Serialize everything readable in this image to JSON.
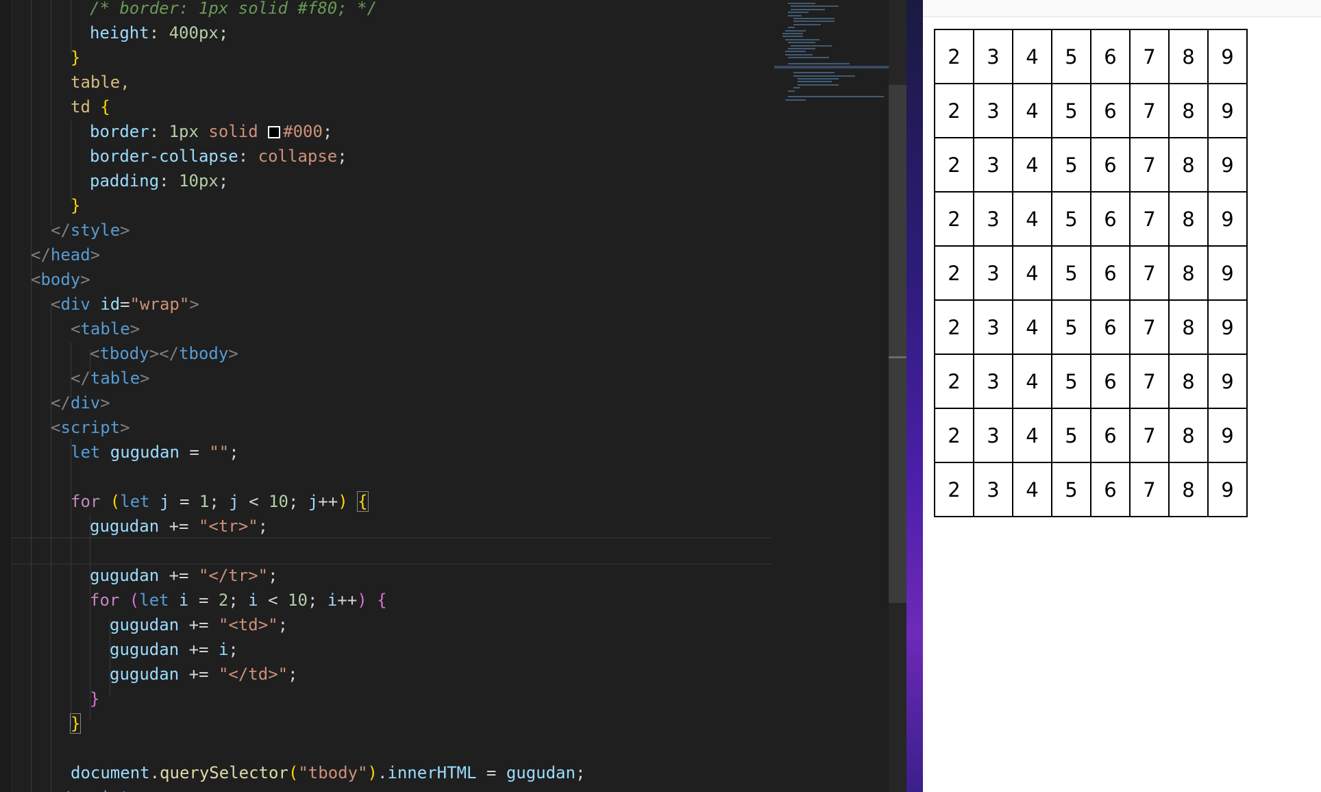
{
  "editor": {
    "lines": [
      [
        {
          "t": "/* border: 1px solid #f80; */",
          "c": "comment"
        }
      ],
      [
        {
          "t": "height",
          "c": "prop"
        },
        {
          "t": ": ",
          "c": "plain"
        },
        {
          "t": "400px",
          "c": "num"
        },
        {
          "t": ";",
          "c": "plain"
        }
      ],
      [
        {
          "t": "}",
          "c": "brace1"
        }
      ],
      [
        {
          "t": "table,",
          "c": "sel"
        }
      ],
      [
        {
          "t": "td ",
          "c": "sel"
        },
        {
          "t": "{",
          "c": "brace1"
        }
      ],
      [
        {
          "t": "border",
          "c": "prop"
        },
        {
          "t": ": ",
          "c": "plain"
        },
        {
          "t": "1px",
          "c": "num"
        },
        {
          "t": " solid ",
          "c": "cssval"
        },
        {
          "t": "",
          "c": "swatch"
        },
        {
          "t": "#000",
          "c": "cssval"
        },
        {
          "t": ";",
          "c": "plain"
        }
      ],
      [
        {
          "t": "border-collapse",
          "c": "prop"
        },
        {
          "t": ": ",
          "c": "plain"
        },
        {
          "t": "collapse",
          "c": "cssval"
        },
        {
          "t": ";",
          "c": "plain"
        }
      ],
      [
        {
          "t": "padding",
          "c": "prop"
        },
        {
          "t": ": ",
          "c": "plain"
        },
        {
          "t": "10px",
          "c": "num"
        },
        {
          "t": ";",
          "c": "plain"
        }
      ],
      [
        {
          "t": "}",
          "c": "brace1"
        }
      ],
      [
        {
          "t": "</",
          "c": "punct"
        },
        {
          "t": "style",
          "c": "tag"
        },
        {
          "t": ">",
          "c": "punct"
        }
      ],
      [
        {
          "t": "</",
          "c": "punct"
        },
        {
          "t": "head",
          "c": "tag"
        },
        {
          "t": ">",
          "c": "punct"
        }
      ],
      [
        {
          "t": "<",
          "c": "punct"
        },
        {
          "t": "body",
          "c": "tag"
        },
        {
          "t": ">",
          "c": "punct"
        }
      ],
      [
        {
          "t": "<",
          "c": "punct"
        },
        {
          "t": "div ",
          "c": "tag"
        },
        {
          "t": "id",
          "c": "attr"
        },
        {
          "t": "=",
          "c": "plain"
        },
        {
          "t": "\"wrap\"",
          "c": "attrval"
        },
        {
          "t": ">",
          "c": "punct"
        }
      ],
      [
        {
          "t": "<",
          "c": "punct"
        },
        {
          "t": "table",
          "c": "tag"
        },
        {
          "t": ">",
          "c": "punct"
        }
      ],
      [
        {
          "t": "<",
          "c": "punct"
        },
        {
          "t": "tbody",
          "c": "tag"
        },
        {
          "t": "></",
          "c": "punct"
        },
        {
          "t": "tbody",
          "c": "tag"
        },
        {
          "t": ">",
          "c": "punct"
        }
      ],
      [
        {
          "t": "</",
          "c": "punct"
        },
        {
          "t": "table",
          "c": "tag"
        },
        {
          "t": ">",
          "c": "punct"
        }
      ],
      [
        {
          "t": "</",
          "c": "punct"
        },
        {
          "t": "div",
          "c": "tag"
        },
        {
          "t": ">",
          "c": "punct"
        }
      ],
      [
        {
          "t": "<",
          "c": "punct"
        },
        {
          "t": "script",
          "c": "tag"
        },
        {
          "t": ">",
          "c": "punct"
        }
      ],
      [
        {
          "t": "let ",
          "c": "kw"
        },
        {
          "t": "gugudan",
          "c": "var"
        },
        {
          "t": " = ",
          "c": "plain"
        },
        {
          "t": "\"\"",
          "c": "str"
        },
        {
          "t": ";",
          "c": "plain"
        }
      ],
      [],
      [
        {
          "t": "for ",
          "c": "ctrl"
        },
        {
          "t": "(",
          "c": "brace1"
        },
        {
          "t": "let ",
          "c": "kw"
        },
        {
          "t": "j",
          "c": "var"
        },
        {
          "t": " = ",
          "c": "plain"
        },
        {
          "t": "1",
          "c": "num"
        },
        {
          "t": "; ",
          "c": "plain"
        },
        {
          "t": "j",
          "c": "var"
        },
        {
          "t": " < ",
          "c": "plain"
        },
        {
          "t": "10",
          "c": "num"
        },
        {
          "t": "; ",
          "c": "plain"
        },
        {
          "t": "j",
          "c": "var"
        },
        {
          "t": "++",
          "c": "plain"
        },
        {
          "t": ") ",
          "c": "brace1"
        },
        {
          "t": "{",
          "c": "brace1 boxed"
        }
      ],
      [
        {
          "t": "gugudan",
          "c": "var"
        },
        {
          "t": " += ",
          "c": "plain"
        },
        {
          "t": "\"<tr>\"",
          "c": "str"
        },
        {
          "t": ";",
          "c": "plain"
        }
      ],
      [],
      [
        {
          "t": "gugudan",
          "c": "var"
        },
        {
          "t": " += ",
          "c": "plain"
        },
        {
          "t": "\"</tr>\"",
          "c": "str"
        },
        {
          "t": ";",
          "c": "plain"
        }
      ],
      [
        {
          "t": "for ",
          "c": "ctrl"
        },
        {
          "t": "(",
          "c": "brace2"
        },
        {
          "t": "let ",
          "c": "kw"
        },
        {
          "t": "i",
          "c": "var"
        },
        {
          "t": " = ",
          "c": "plain"
        },
        {
          "t": "2",
          "c": "num"
        },
        {
          "t": "; ",
          "c": "plain"
        },
        {
          "t": "i",
          "c": "var"
        },
        {
          "t": " < ",
          "c": "plain"
        },
        {
          "t": "10",
          "c": "num"
        },
        {
          "t": "; ",
          "c": "plain"
        },
        {
          "t": "i",
          "c": "var"
        },
        {
          "t": "++",
          "c": "plain"
        },
        {
          "t": ") ",
          "c": "brace2"
        },
        {
          "t": "{",
          "c": "brace2"
        }
      ],
      [
        {
          "t": "gugudan",
          "c": "var"
        },
        {
          "t": " += ",
          "c": "plain"
        },
        {
          "t": "\"<td>\"",
          "c": "str"
        },
        {
          "t": ";",
          "c": "plain"
        }
      ],
      [
        {
          "t": "gugudan",
          "c": "var"
        },
        {
          "t": " += ",
          "c": "plain"
        },
        {
          "t": "i",
          "c": "var"
        },
        {
          "t": ";",
          "c": "plain"
        }
      ],
      [
        {
          "t": "gugudan",
          "c": "var"
        },
        {
          "t": " += ",
          "c": "plain"
        },
        {
          "t": "\"</td>\"",
          "c": "str"
        },
        {
          "t": ";",
          "c": "plain"
        }
      ],
      [
        {
          "t": "}",
          "c": "brace2"
        }
      ],
      [
        {
          "t": "}",
          "c": "brace1 boxed"
        }
      ],
      [],
      [
        {
          "t": "document",
          "c": "var"
        },
        {
          "t": ".",
          "c": "plain"
        },
        {
          "t": "querySelector",
          "c": "fn"
        },
        {
          "t": "(",
          "c": "brace1"
        },
        {
          "t": "\"tbody\"",
          "c": "str"
        },
        {
          "t": ")",
          "c": "brace1"
        },
        {
          "t": ".",
          "c": "plain"
        },
        {
          "t": "innerHTML",
          "c": "var"
        },
        {
          "t": " = ",
          "c": "plain"
        },
        {
          "t": "gugudan",
          "c": "var"
        },
        {
          "t": ";",
          "c": "plain"
        }
      ],
      [
        {
          "t": "</",
          "c": "punct"
        },
        {
          "t": "script",
          "c": "tag"
        },
        {
          "t": ">",
          "c": "punct"
        }
      ]
    ]
  },
  "browser": {
    "table_rows": [
      [
        "2",
        "3",
        "4",
        "5",
        "6",
        "7",
        "8",
        "9"
      ],
      [
        "2",
        "3",
        "4",
        "5",
        "6",
        "7",
        "8",
        "9"
      ],
      [
        "2",
        "3",
        "4",
        "5",
        "6",
        "7",
        "8",
        "9"
      ],
      [
        "2",
        "3",
        "4",
        "5",
        "6",
        "7",
        "8",
        "9"
      ],
      [
        "2",
        "3",
        "4",
        "5",
        "6",
        "7",
        "8",
        "9"
      ],
      [
        "2",
        "3",
        "4",
        "5",
        "6",
        "7",
        "8",
        "9"
      ],
      [
        "2",
        "3",
        "4",
        "5",
        "6",
        "7",
        "8",
        "9"
      ],
      [
        "2",
        "3",
        "4",
        "5",
        "6",
        "7",
        "8",
        "9"
      ],
      [
        "2",
        "3",
        "4",
        "5",
        "6",
        "7",
        "8",
        "9"
      ]
    ]
  }
}
